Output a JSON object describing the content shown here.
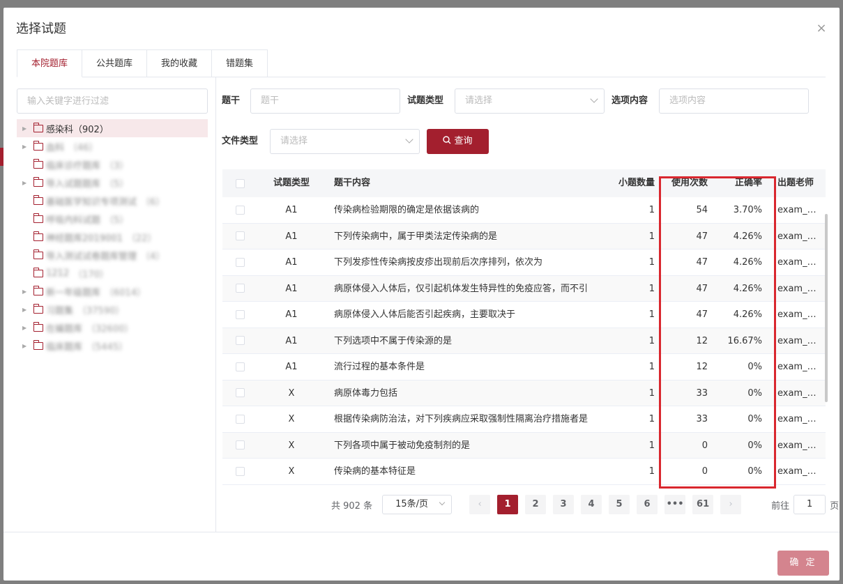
{
  "dialog": {
    "title": "选择试题",
    "close_glyph": "×"
  },
  "tabs": [
    {
      "label": "本院题库",
      "active": true
    },
    {
      "label": "公共题库",
      "active": false
    },
    {
      "label": "我的收藏",
      "active": false
    },
    {
      "label": "错题集",
      "active": false
    }
  ],
  "tree": {
    "filter_placeholder": "输入关键字进行过滤",
    "nodes": [
      {
        "label": "感染科",
        "count": "（902）",
        "expandable": true,
        "active": true,
        "blurred": false
      },
      {
        "label": "血科",
        "count": "（46）",
        "expandable": true,
        "blurred": true
      },
      {
        "label": "临床诊疗题库",
        "count": "（3）",
        "expandable": false,
        "blurred": true
      },
      {
        "label": "导入试题题库",
        "count": "（5）",
        "expandable": true,
        "blurred": true
      },
      {
        "label": "基础医学知识专项测试",
        "count": "（6）",
        "expandable": false,
        "blurred": true
      },
      {
        "label": "呼吸内科试题",
        "count": "（5）",
        "expandable": false,
        "blurred": true
      },
      {
        "label": "神经题库2019001",
        "count": "（22）",
        "expandable": false,
        "blurred": true
      },
      {
        "label": "导入测试试卷题库管理",
        "count": "（4）",
        "expandable": false,
        "blurred": true
      },
      {
        "label": "1212",
        "count": "（170）",
        "expandable": false,
        "blurred": true
      },
      {
        "label": "新一年级题库",
        "count": "（6014）",
        "expandable": true,
        "blurred": true
      },
      {
        "label": "习题集",
        "count": "（37590）",
        "expandable": true,
        "blurred": true
      },
      {
        "label": "在编题库",
        "count": "（32600）",
        "expandable": true,
        "blurred": true
      },
      {
        "label": "临床题库",
        "count": "（5445）",
        "expandable": true,
        "blurred": true
      }
    ]
  },
  "search": {
    "stem_label": "题干",
    "stem_placeholder": "题干",
    "type_label": "试题类型",
    "type_placeholder": "请选择",
    "option_label": "选项内容",
    "option_placeholder": "选项内容",
    "file_type_label": "文件类型",
    "file_type_placeholder": "请选择",
    "query_button": "查询"
  },
  "table": {
    "headers": {
      "type": "试题类型",
      "content": "题干内容",
      "sub_count": "小题数量",
      "use_count": "使用次数",
      "accuracy": "正确率",
      "teacher": "出题老师"
    },
    "rows": [
      {
        "type": "A1",
        "content": "传染病检验期限的确定是依据该病的",
        "sub": "1",
        "use": "54",
        "rate": "3.70%",
        "teacher": "exam_…"
      },
      {
        "type": "A1",
        "content": "下列传染病中，属于甲类法定传染病的是",
        "sub": "1",
        "use": "47",
        "rate": "4.26%",
        "teacher": "exam_…"
      },
      {
        "type": "A1",
        "content": "下列发疹性传染病按皮疹出现前后次序排列，依次为",
        "sub": "1",
        "use": "47",
        "rate": "4.26%",
        "teacher": "exam_…"
      },
      {
        "type": "A1",
        "content": "病原体侵入人体后，仅引起机体发生特异性的免疫应答，而不引",
        "sub": "1",
        "use": "47",
        "rate": "4.26%",
        "teacher": "exam_…"
      },
      {
        "type": "A1",
        "content": "病原体侵入人体后能否引起疾病，主要取决于",
        "sub": "1",
        "use": "47",
        "rate": "4.26%",
        "teacher": "exam_…"
      },
      {
        "type": "A1",
        "content": "下列选项中不属于传染源的是",
        "sub": "1",
        "use": "12",
        "rate": "16.67%",
        "teacher": "exam_…"
      },
      {
        "type": "A1",
        "content": "流行过程的基本条件是",
        "sub": "1",
        "use": "12",
        "rate": "0%",
        "teacher": "exam_…"
      },
      {
        "type": "X",
        "content": "病原体毒力包括",
        "sub": "1",
        "use": "33",
        "rate": "0%",
        "teacher": "exam_…"
      },
      {
        "type": "X",
        "content": "根据传染病防治法，对下列疾病应采取强制性隔离治疗措施者是",
        "sub": "1",
        "use": "33",
        "rate": "0%",
        "teacher": "exam_…"
      },
      {
        "type": "X",
        "content": "下列各项中属于被动免疫制剂的是",
        "sub": "1",
        "use": "0",
        "rate": "0%",
        "teacher": "exam_…"
      },
      {
        "type": "X",
        "content": "传染病的基本特征是",
        "sub": "1",
        "use": "0",
        "rate": "0%",
        "teacher": "exam_…"
      }
    ]
  },
  "pagination": {
    "total": "共 902 条",
    "page_size": "15条/页",
    "prev": "‹",
    "next": "›",
    "pages": [
      "1",
      "2",
      "3",
      "4",
      "5",
      "6",
      "•••",
      "61"
    ],
    "current": "1",
    "goto_label": "前往",
    "goto_value": "1",
    "goto_suffix": "页"
  },
  "footer": {
    "confirm": "确 定"
  },
  "colors": {
    "accent": "#a31f2e",
    "highlight": "#d9272e",
    "confirm_disabled": "#d4848e"
  }
}
